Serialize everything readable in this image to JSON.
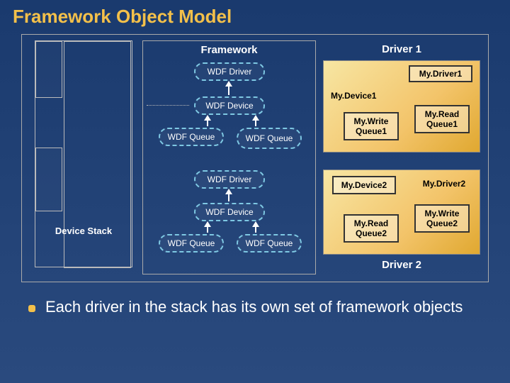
{
  "title": "Framework Object Model",
  "framework": {
    "label": "Framework",
    "wdf_driver": "WDF Driver",
    "wdf_device": "WDF Device",
    "wdf_queue": "WDF Queue"
  },
  "device_stack": {
    "label": "Device Stack"
  },
  "driver1": {
    "title": "Driver 1",
    "my_driver": "My.Driver1",
    "my_device": "My.Device1",
    "write_q": "My.Write Queue1",
    "read_q": "My.Read Queue1"
  },
  "driver2": {
    "title": "Driver 2",
    "my_driver": "My.Driver2",
    "my_device": "My.Device2",
    "write_q": "My.Write Queue2",
    "read_q": "My.Read Queue2"
  },
  "footer": "Each driver in the stack has its own set of framework objects",
  "colors": {
    "accent": "#f3c04a",
    "panel": "#f3c46a"
  }
}
